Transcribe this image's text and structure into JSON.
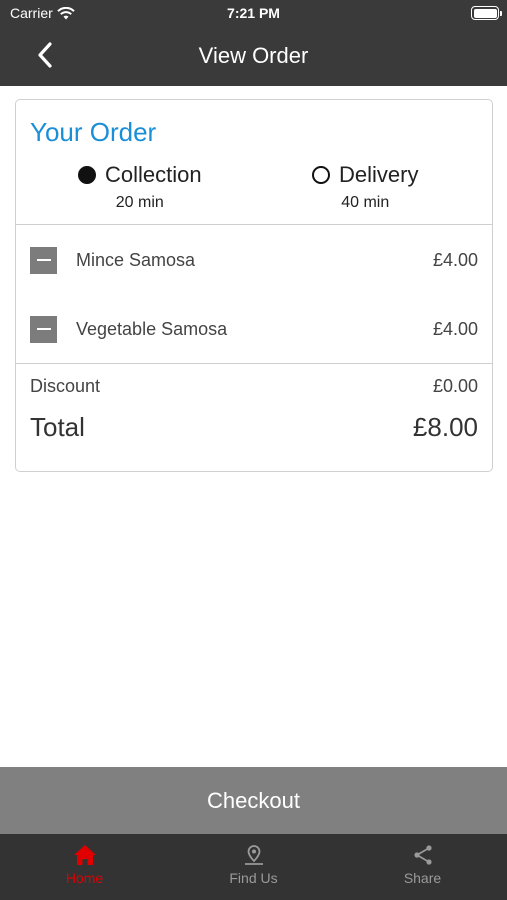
{
  "status_bar": {
    "carrier": "Carrier",
    "time": "7:21 PM"
  },
  "nav": {
    "title": "View Order",
    "back_icon": "chevron-left-icon"
  },
  "order": {
    "heading": "Your Order",
    "heading_color": "#1a8fd8",
    "options": [
      {
        "label": "Collection",
        "time": "20 min",
        "selected": true
      },
      {
        "label": "Delivery",
        "time": "40 min",
        "selected": false
      }
    ],
    "items": [
      {
        "name": "Mince Samosa",
        "price": "£4.00"
      },
      {
        "name": "Vegetable Samosa",
        "price": "£4.00"
      }
    ],
    "discount_label": "Discount",
    "discount_value": "£0.00",
    "total_label": "Total",
    "total_value": "£8.00"
  },
  "checkout_label": "Checkout",
  "tabs": [
    {
      "label": "Home",
      "icon": "home-icon",
      "active": true,
      "color": "#e00000"
    },
    {
      "label": "Find Us",
      "icon": "map-pin-icon",
      "active": false
    },
    {
      "label": "Share",
      "icon": "share-icon",
      "active": false
    }
  ]
}
